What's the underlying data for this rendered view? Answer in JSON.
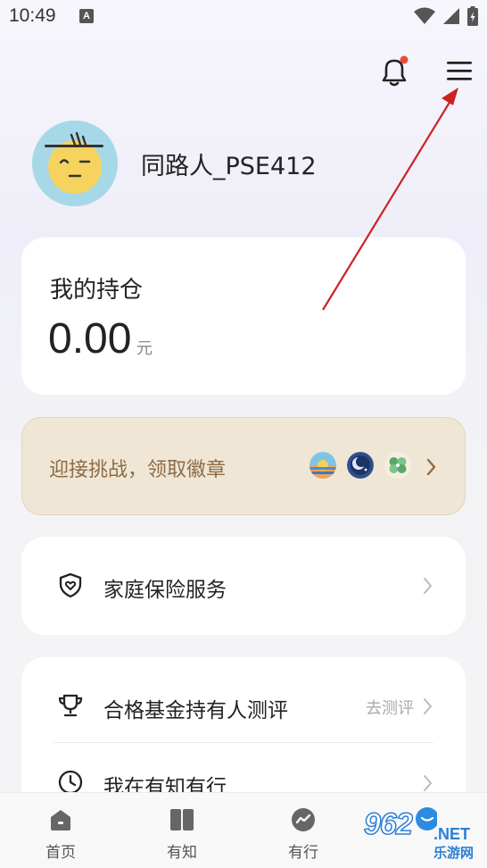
{
  "status_bar": {
    "time": "10:49",
    "notification_badge": "A"
  },
  "header": {
    "bell_has_dot": true,
    "accent_red": "#e74c3c"
  },
  "profile": {
    "username": "同路人_PSE412",
    "avatar_icon": "cartoon-face-avatar"
  },
  "holdings": {
    "title": "我的持仓",
    "value": "0.00",
    "unit": "元"
  },
  "challenge": {
    "text": "迎接挑战，领取徽章",
    "badges": [
      "sunset-badge",
      "moon-badge",
      "clover-badge"
    ],
    "text_color": "#8d6c45",
    "background": "#efe6d6"
  },
  "insurance": {
    "label": "家庭保险服务",
    "icon": "shield-heart-icon"
  },
  "services": {
    "items": [
      {
        "label": "合格基金持有人测评",
        "right_text": "去测评",
        "icon": "trophy-icon"
      },
      {
        "label": "我在有知有行",
        "right_text": "",
        "icon": "clock-icon"
      }
    ]
  },
  "tabbar": {
    "tabs": [
      {
        "label": "首页",
        "icon": "home-icon"
      },
      {
        "label": "有知",
        "icon": "book-icon"
      },
      {
        "label": "有行",
        "icon": "trend-icon"
      },
      {
        "label": "",
        "icon": "profile-icon"
      }
    ]
  },
  "watermark": {
    "brand": "962",
    "net": ".NET",
    "sub": "乐游网"
  }
}
